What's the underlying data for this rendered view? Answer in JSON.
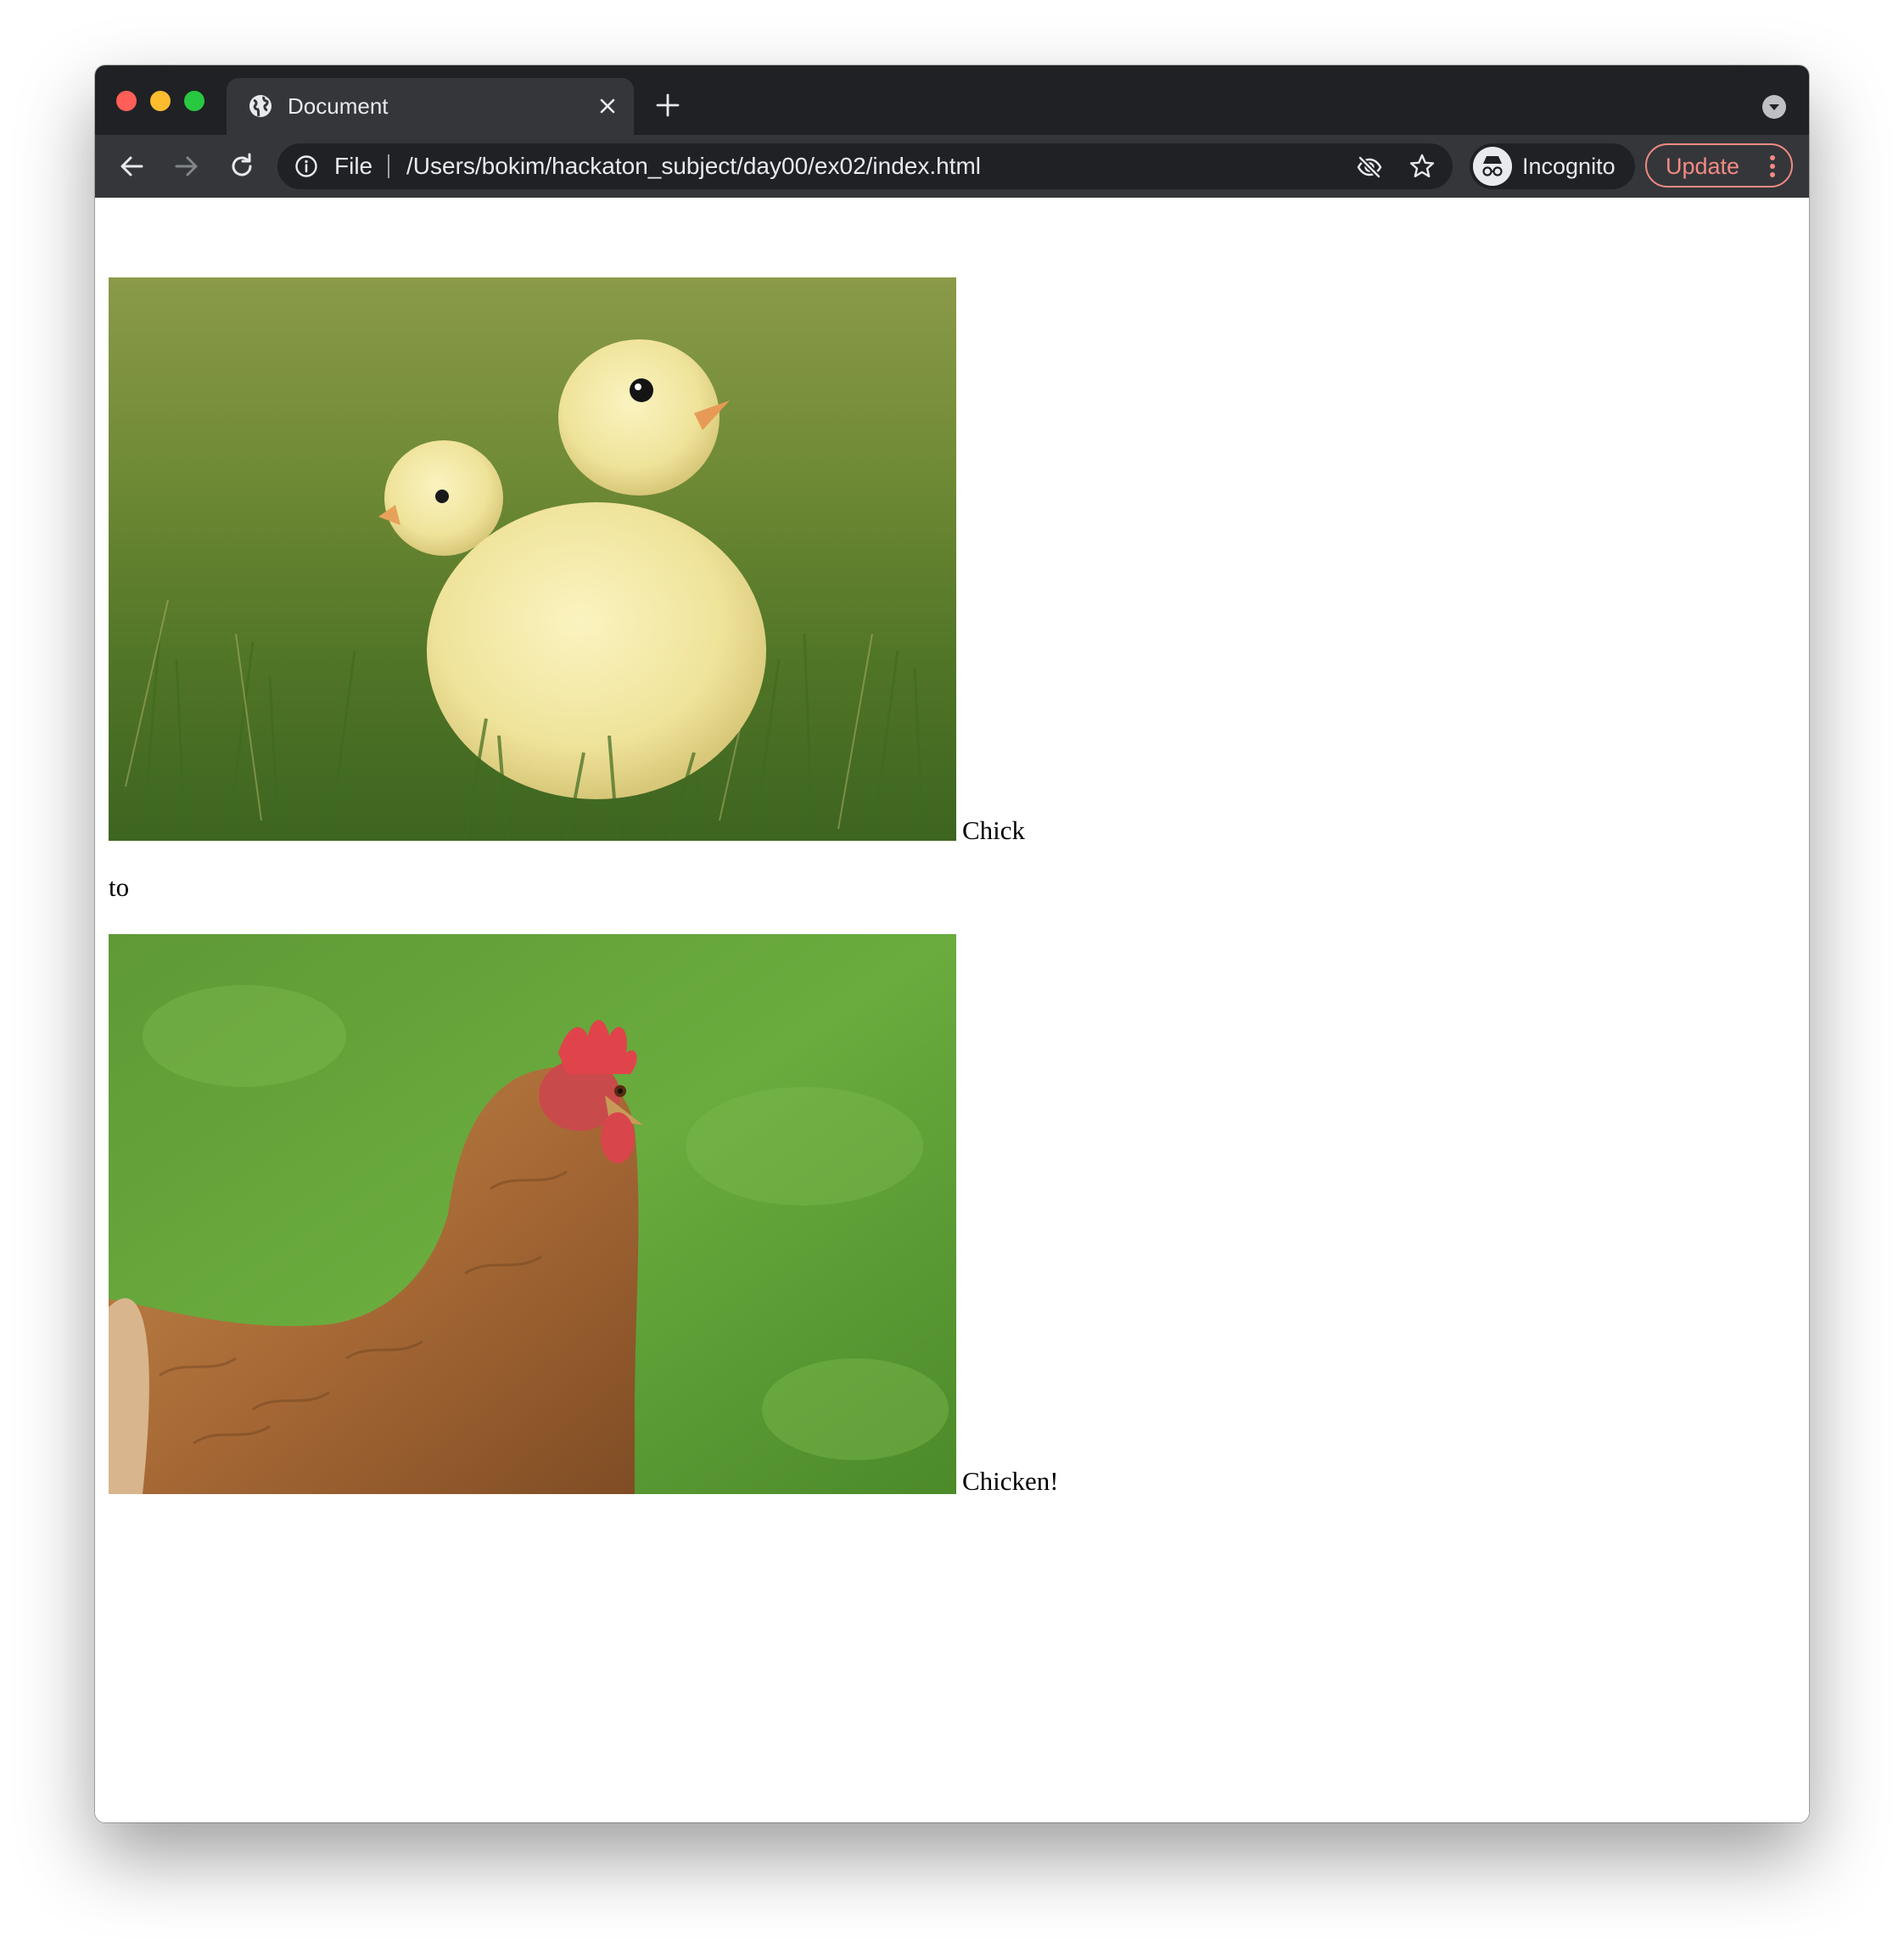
{
  "browser": {
    "tab": {
      "title": "Document",
      "icon": "globe-icon"
    },
    "address_bar": {
      "scheme_label": "File",
      "url": "/Users/bokim/hackaton_subject/day00/ex02/index.html"
    },
    "profile": {
      "label": "Incognito",
      "icon": "incognito-icon"
    },
    "update_button": {
      "label": "Update",
      "color": "#f28b82"
    },
    "colors": {
      "titlebar": "#202124",
      "toolbar": "#35363a",
      "traffic_red": "#ff5f57",
      "traffic_yellow": "#febc2e",
      "traffic_green": "#28c840"
    }
  },
  "page": {
    "items": [
      {
        "image": "chick-photo",
        "caption": "Chick"
      },
      {
        "text": "to"
      },
      {
        "image": "chicken-photo",
        "caption": "Chicken!"
      }
    ]
  }
}
